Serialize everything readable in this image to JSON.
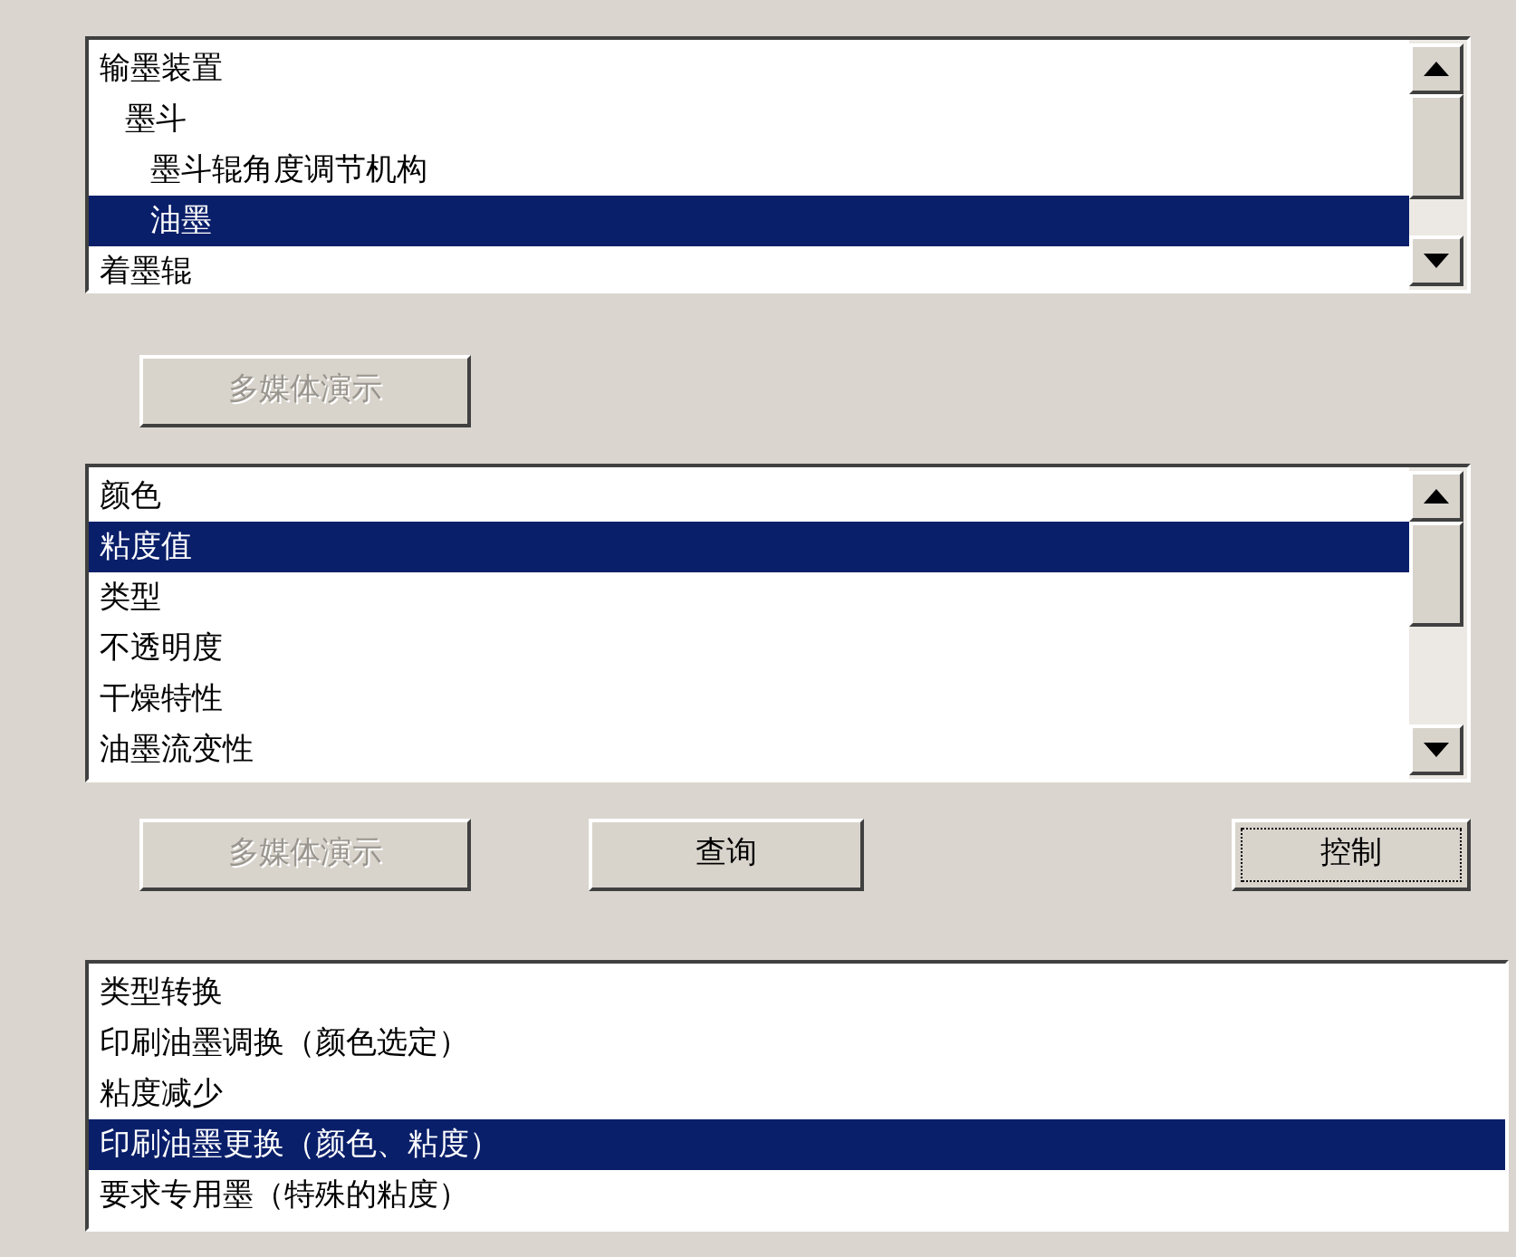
{
  "component_tree": {
    "items": [
      {
        "label": "输墨装置",
        "selected": false,
        "children": [
          {
            "label": "墨斗",
            "selected": false,
            "children": [
              {
                "label": "墨斗辊角度调节机构",
                "selected": false
              },
              {
                "label": "油墨",
                "selected": true
              }
            ]
          }
        ]
      },
      {
        "label": "着墨辊",
        "selected": false
      }
    ]
  },
  "demo_button": {
    "label": "多媒体演示",
    "disabled": true,
    "focused": false
  },
  "property_list": {
    "items": [
      {
        "label": "颜色",
        "selected": false
      },
      {
        "label": "粘度值",
        "selected": true
      },
      {
        "label": "类型",
        "selected": false
      },
      {
        "label": "不透明度",
        "selected": false
      },
      {
        "label": "干燥特性",
        "selected": false
      },
      {
        "label": "油墨流变性",
        "selected": false
      }
    ]
  },
  "action_buttons": [
    {
      "label": "多媒体演示",
      "disabled": true,
      "focused": false
    },
    {
      "label": "查询",
      "disabled": false,
      "focused": false
    },
    {
      "label": "控制",
      "disabled": false,
      "focused": true
    }
  ],
  "operation_list": {
    "items": [
      {
        "label": "类型转换",
        "selected": false
      },
      {
        "label": "印刷油墨调换（颜色选定）",
        "selected": false
      },
      {
        "label": "粘度减少",
        "selected": false
      },
      {
        "label": "印刷油墨更换（颜色、粘度）",
        "selected": true
      },
      {
        "label": "要求专用墨（特殊的粘度）",
        "selected": false
      }
    ]
  }
}
